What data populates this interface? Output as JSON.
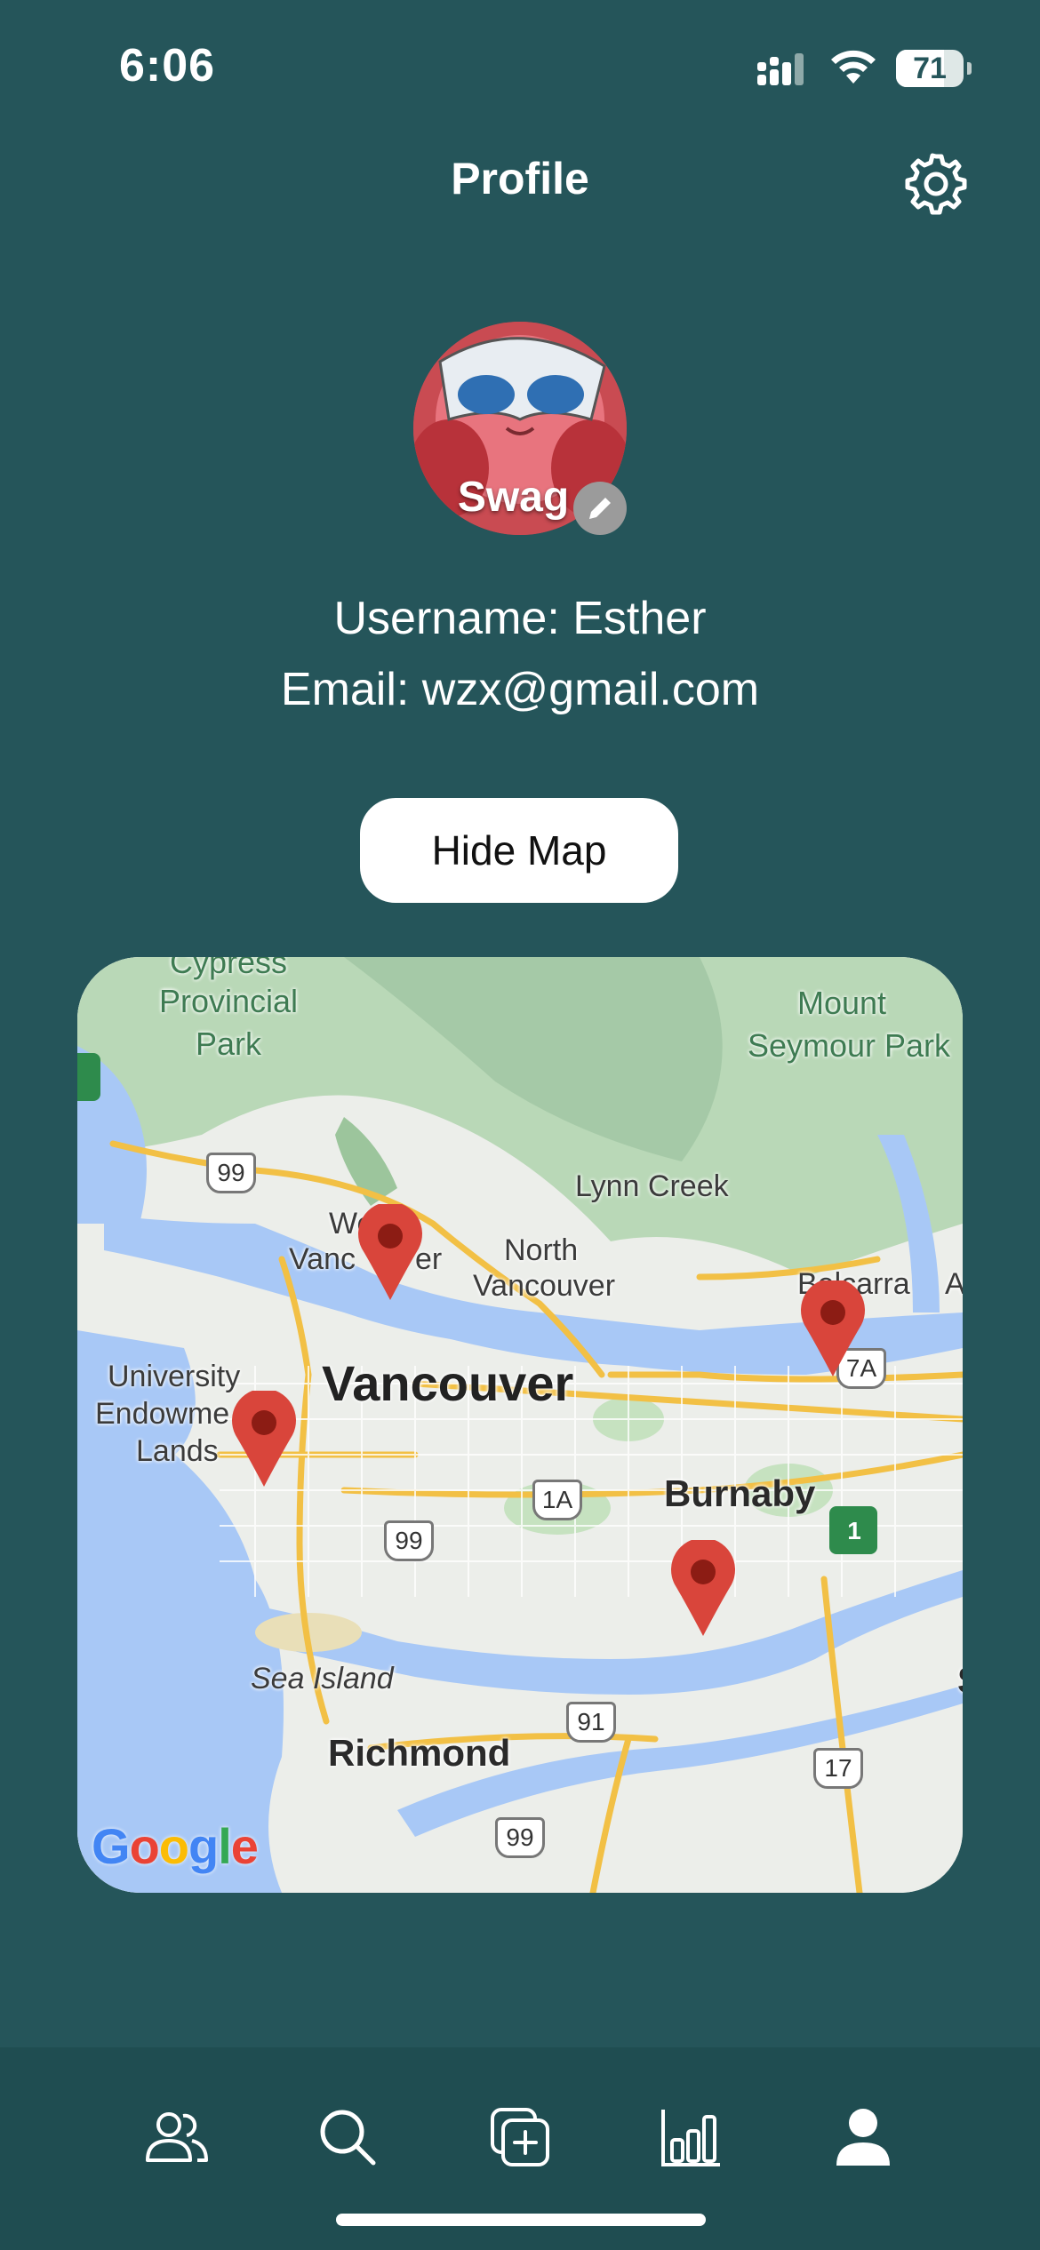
{
  "status_bar": {
    "time": "6:06",
    "battery": "71",
    "battery_level": 0.71
  },
  "header": {
    "title": "Profile",
    "settings_icon": "gear-icon"
  },
  "profile": {
    "avatar_text": "Swag",
    "edit_icon": "pencil-icon",
    "username_line": "Username: Esther",
    "email_line": "Email: wzx@gmail.com"
  },
  "map_toggle": {
    "label": "Hide Map"
  },
  "map": {
    "labels": {
      "cypress": "Cypress",
      "provincial": "Provincial",
      "park": "Park",
      "mount": "Mount",
      "seymour": "Seymour Park",
      "lynn_creek": "Lynn Creek",
      "we": "We",
      "vanc": "Vanc",
      "er": "er",
      "north": "North",
      "north_vancouver": "Vancouver",
      "belcarra": "Belcarra",
      "a": "A",
      "university": "University",
      "endowme": "Endowme",
      "lands": "Lands",
      "vancouver": "Vancouver",
      "burnaby": "Burnaby",
      "sea_island": "Sea Island",
      "richmond": "Richmond",
      "s": "S"
    },
    "shields": {
      "hwy99_a": "99",
      "hwy99_b": "99",
      "hwy99_c": "99",
      "hwy1a": "1A",
      "hwy91": "91",
      "hwy17": "17",
      "hwy7a": "7A",
      "hwy1": "1"
    },
    "google": {
      "g1": "G",
      "o1": "o",
      "o2": "o",
      "g2": "g",
      "l": "l",
      "e": "e",
      "colors": [
        "#4285F4",
        "#EA4335",
        "#FBBC05",
        "#4285F4",
        "#34A853",
        "#EA4335"
      ]
    },
    "pin_color": "#d9453b",
    "pin_count": 4
  },
  "tab_bar": {
    "tabs": [
      {
        "name": "friends",
        "icon": "people-icon"
      },
      {
        "name": "search",
        "icon": "search-icon"
      },
      {
        "name": "add",
        "icon": "add-square-icon"
      },
      {
        "name": "stats",
        "icon": "bar-chart-icon"
      },
      {
        "name": "profile",
        "icon": "person-icon",
        "active": true
      }
    ]
  },
  "colors": {
    "background": "#25555a",
    "tab_bar": "#1f4d51",
    "button": "#ffffff"
  }
}
